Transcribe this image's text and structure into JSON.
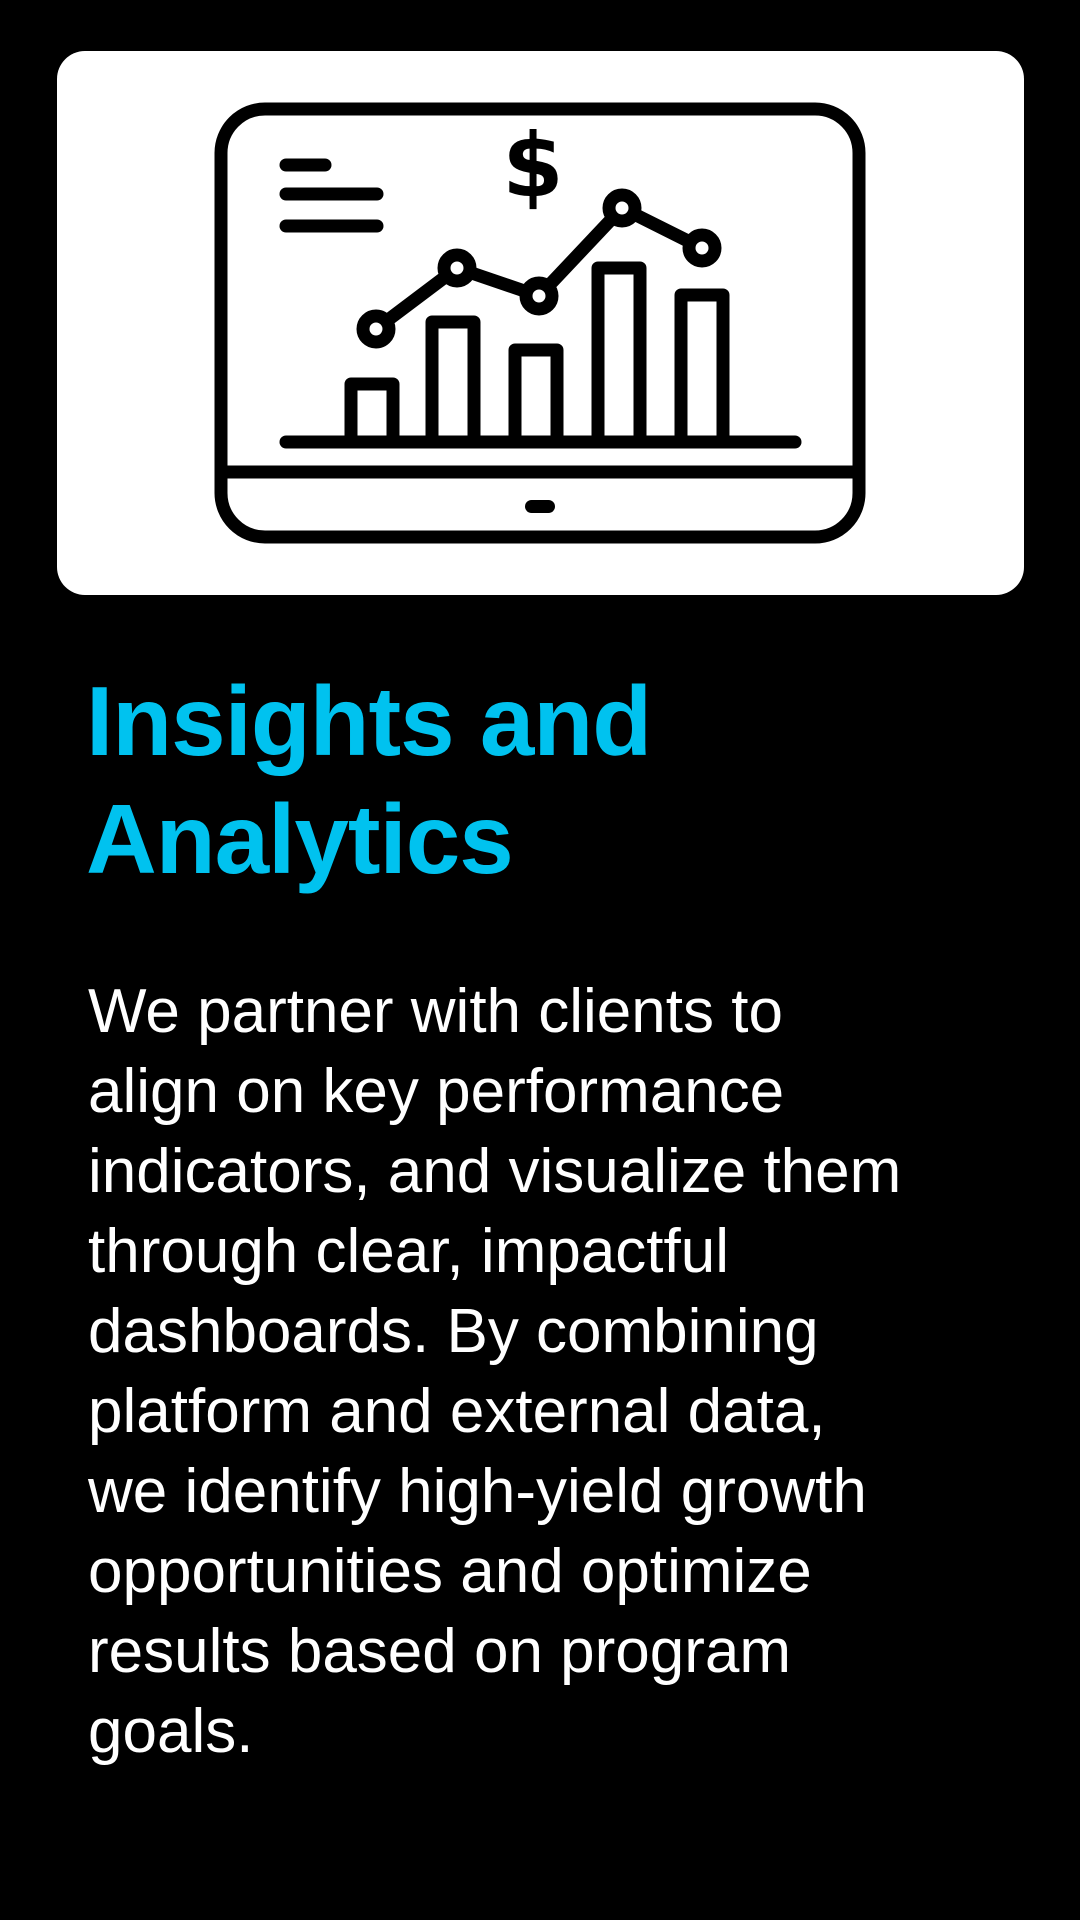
{
  "colors": {
    "background": "#000000",
    "card": "#ffffff",
    "icon_stroke": "#000000",
    "accent": "#00c2ef",
    "body_text": "#ffffff"
  },
  "illustration": {
    "icon": "analytics-dashboard-monitor-icon",
    "chart_icon": "bar-and-line-chart-icon",
    "currency_symbol": "$"
  },
  "heading": {
    "lines": [
      "Insights and",
      "Analytics"
    ]
  },
  "description": {
    "lines": [
      "We partner with clients to",
      "align on key performance",
      "indicators, and visualize them",
      "through clear, impactful",
      "dashboards. By combining",
      "platform and external data,",
      "we identify high-yield growth",
      "opportunities and optimize",
      "results based on program",
      "goals."
    ]
  }
}
